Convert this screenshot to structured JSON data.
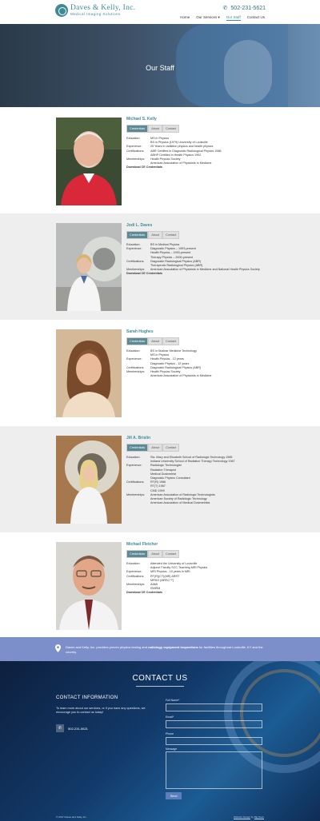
{
  "header": {
    "logo_name": "Daves & Kelly, Inc.",
    "logo_sub": "Medical Imaging Solutions",
    "phone": "502-231-5621",
    "nav": [
      {
        "label": "Home"
      },
      {
        "label": "Our Services ▾"
      },
      {
        "label": "Our Staff"
      },
      {
        "label": "Contact Us"
      }
    ]
  },
  "hero": {
    "title": "Our Staff"
  },
  "tabs": {
    "credentials": "Credentials",
    "about": "About",
    "contact": "Contact"
  },
  "staff": [
    {
      "name": "Michael S. Kelly",
      "rows": [
        {
          "label": "Education:",
          "lines": [
            "MS in Physics",
            "BS in Physics (1979) University of Louisville"
          ]
        },
        {
          "label": "Experience:",
          "lines": [
            "25 Years in radiation physics and health physics"
          ]
        },
        {
          "label": "Certifications:",
          "lines": [
            "ABR Certified in Diagnostic Radiological Physics 1986",
            "ABHP Certified in Health Physics 1992"
          ]
        },
        {
          "label": "Memberships:",
          "lines": [
            "Health Physics Society",
            "American Association of Physicists in Medicine"
          ]
        }
      ],
      "download": "Download CE Credentials"
    },
    {
      "name": "Jodi L. Daves",
      "rows": [
        {
          "label": "Education:",
          "lines": [
            "BS in Medical Physics"
          ]
        },
        {
          "label": "Experience:",
          "lines": [
            "Diagnostic Physics – 1993-present",
            "Health Physics – 1993-present",
            "Therapy Physics – 2000-present"
          ]
        },
        {
          "label": "Certifications:",
          "lines": [
            "Diagnostic Radiological Physics (ABR)",
            "Therapeutic Radiological Physics (ABR)"
          ]
        },
        {
          "label": "Memberships:",
          "lines": [
            "American Association of Physicists in Medicine and National Health Physics Society"
          ]
        }
      ],
      "download": "Download CE Credentials"
    },
    {
      "name": "Sarah Hughes",
      "rows": [
        {
          "label": "Education:",
          "lines": [
            "BS in Nuclear Medicine Technology",
            "MS in Physics"
          ]
        },
        {
          "label": "Experience:",
          "lines": [
            "Health Physics - 12 years",
            "Diagnostic Physics - 12 years"
          ]
        },
        {
          "label": "Certifications:",
          "lines": [
            "Diagnostic Radiological Physics (ABR)"
          ]
        },
        {
          "label": "Memberships:",
          "lines": [
            "Health Physics Society",
            "American Association of Physicists in Medicine"
          ]
        }
      ],
      "download": ""
    },
    {
      "name": "Jill A. Brislin",
      "rows": [
        {
          "label": "Education:",
          "lines": [
            "Sts. Mary and Elizabeth School of Radiologic Technology 1985",
            "Indiana University School of Radiation Therapy Technology 1987"
          ]
        },
        {
          "label": "Experience:",
          "lines": [
            "Radiologic Technologist",
            "Radiation Therapist",
            "Medical Dosimetrist",
            "Diagnostic Physics Consultant"
          ]
        },
        {
          "label": "Certifications:",
          "lines": [
            "RT(R) 1986",
            "RT(T) 1987",
            "CMD 1999"
          ]
        },
        {
          "label": "Memberships:",
          "lines": [
            "American Association of Radiologic Technologists",
            "American Society of Radiologic Technology",
            "American Association of Medical Dosimetrists"
          ]
        }
      ],
      "download": ""
    },
    {
      "name": "Michael Fletcher",
      "rows": [
        {
          "label": "Education:",
          "lines": [
            "Attended the University of Louisville",
            "Adjunct Faculty SCC Teaching MRI Physics"
          ]
        },
        {
          "label": "Experience:",
          "lines": [
            "MRI Physics - 10 years in MRI"
          ]
        },
        {
          "label": "Certifications:",
          "lines": [
            "RT(R)(CT)(MR) ARRT",
            "MRSO (MRSC™)"
          ]
        },
        {
          "label": "Memberships:",
          "lines": [
            "AAMI",
            "ISMRM"
          ]
        }
      ],
      "download": "Download CE Credentials"
    }
  ],
  "banner": {
    "text_a": "Daves and Kelly, Inc. provides proven physics testing and ",
    "text_b": "radiology equipment inspections",
    "text_c": " for facilities throughout Louisville, KY and the country."
  },
  "contact": {
    "title": "CONTACT US",
    "info_title": "CONTACT INFORMATION",
    "info_text": "To learn more about our services, or if you have any questions, we encourage you to contact us today!",
    "phone": "502-231-5621",
    "form": {
      "full_name": "Full Name*",
      "email": "Email*",
      "phone": "Phone",
      "message": "Message",
      "send": "Send"
    },
    "footer_left": "© 2017 Daves and Kelly, Inc.",
    "footer_right_a": "Website Design",
    "footer_right_b": " by ",
    "footer_right_c": "Big Dave"
  }
}
